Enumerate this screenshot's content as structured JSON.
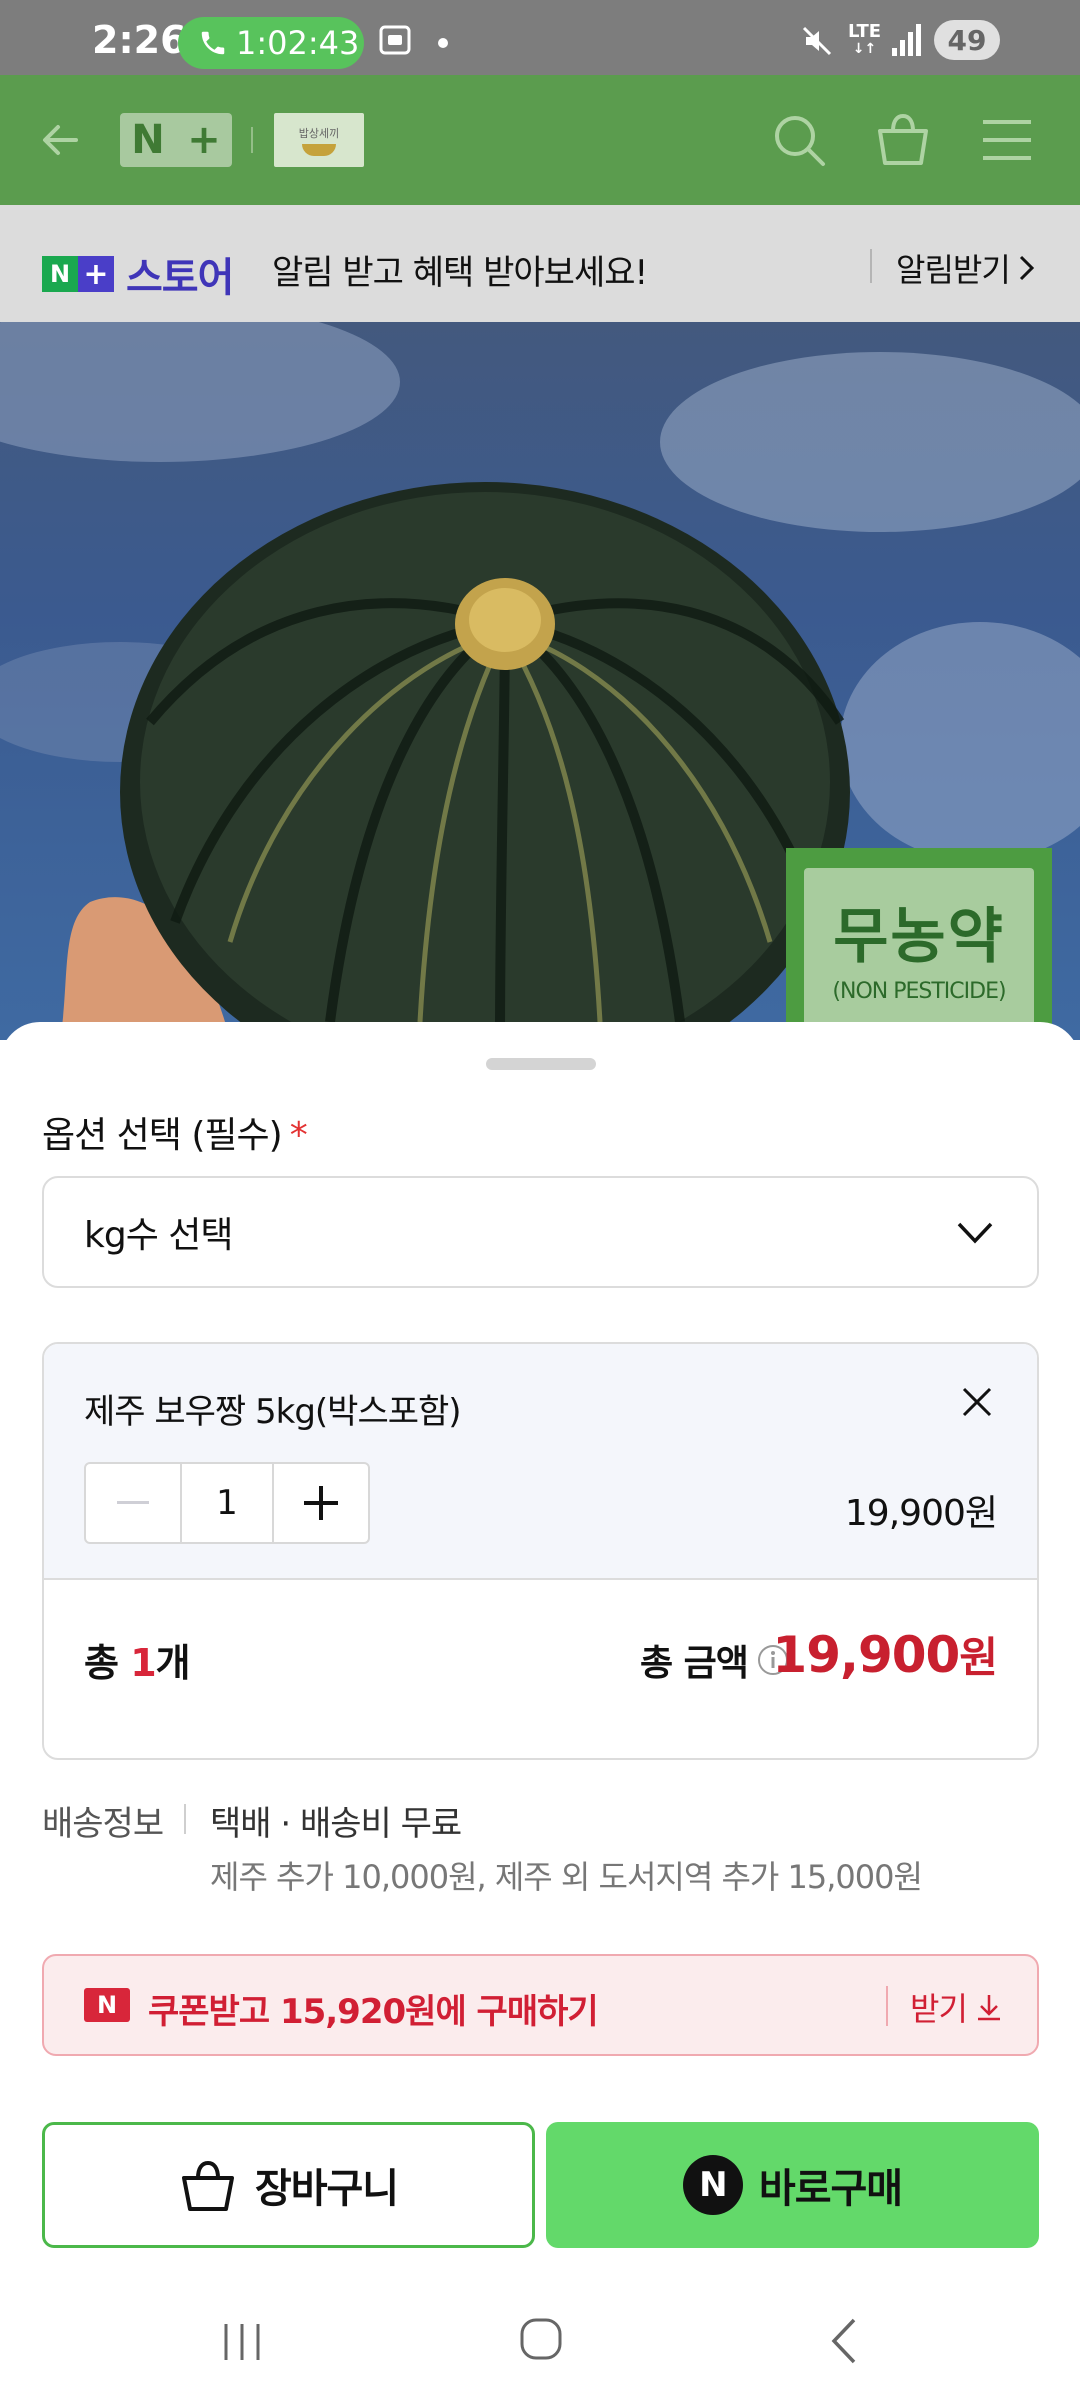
{
  "status_bar": {
    "time": "2:26",
    "call_duration": "1:02:43",
    "network": "LTE",
    "battery": "49"
  },
  "header": {
    "logo_n": "N",
    "logo_plus": "+",
    "store_logo_text": "밥상세끼"
  },
  "notice": {
    "store_brand": "스토어",
    "message": "알림 받고 혜택 받아보세요!",
    "action": "알림받기"
  },
  "product_image": {
    "badge_main": "무농약",
    "badge_sub": "(NON PESTICIDE)"
  },
  "sheet": {
    "option_label": "옵션 선택 (필수)",
    "required_mark": "*",
    "select_value": "kg수 선택",
    "item": {
      "name": "제주 보우짱 5kg(박스포함)",
      "quantity": "1",
      "price": "19,900원"
    },
    "total": {
      "count_prefix": "총 ",
      "count_value": "1",
      "count_suffix": "개",
      "amount_label": "총 금액",
      "amount": "19,900",
      "amount_unit": "원"
    },
    "shipping": {
      "label": "배송정보",
      "method": "택배 · 배송비 무료",
      "extra": "제주 추가 10,000원, 제주 외 도서지역 추가 15,000원"
    },
    "coupon": {
      "badge": "N",
      "text": "쿠폰받고 15,920원에 구매하기",
      "action": "받기"
    },
    "buttons": {
      "cart": "장바구니",
      "buy_badge": "N",
      "buy": "바로구매"
    }
  },
  "colors": {
    "header_green": "#5b9c4e",
    "accent_red": "#c8202f",
    "buy_green": "#63d96a"
  }
}
